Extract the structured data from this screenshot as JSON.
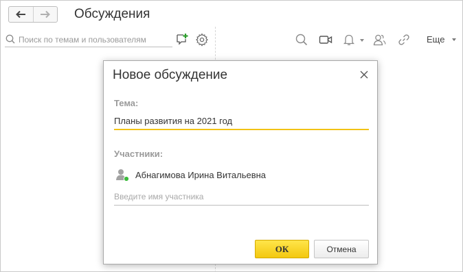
{
  "header": {
    "title": "Обсуждения",
    "back_icon": "arrow-left-icon",
    "forward_icon": "arrow-right-icon"
  },
  "sidebar": {
    "search_placeholder": "Поиск по темам и пользователям",
    "new_topic_icon": "new-discussion-icon",
    "settings_icon": "gear-icon"
  },
  "toolbar": {
    "icons": [
      "search-icon",
      "video-call-icon",
      "bell-icon",
      "users-icon",
      "link-icon"
    ],
    "more_label": "Еще"
  },
  "dialog": {
    "title": "Новое обсуждение",
    "topic_label": "Тема:",
    "topic_value": "Планы развития на 2021 год",
    "participants_label": "Участники:",
    "participants": [
      {
        "name": "Абнагимова Ирина Витальевна",
        "status": "online"
      }
    ],
    "participant_input_placeholder": "Введите имя участника",
    "ok_label": "ОК",
    "cancel_label": "Отмена"
  },
  "colors": {
    "accent_yellow": "#f2c315",
    "online_green": "#3dbb3d",
    "new_topic_green": "#2e9e2e"
  }
}
